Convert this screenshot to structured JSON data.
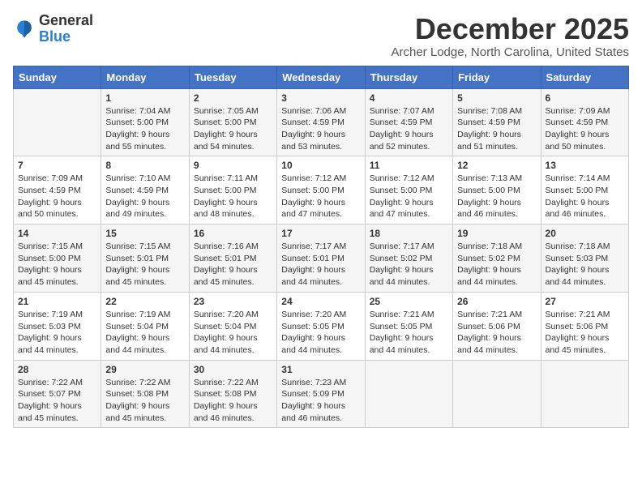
{
  "header": {
    "logo_general": "General",
    "logo_blue": "Blue",
    "month_title": "December 2025",
    "subtitle": "Archer Lodge, North Carolina, United States"
  },
  "days_of_week": [
    "Sunday",
    "Monday",
    "Tuesday",
    "Wednesday",
    "Thursday",
    "Friday",
    "Saturday"
  ],
  "weeks": [
    [
      {
        "day": "",
        "info": ""
      },
      {
        "day": "1",
        "info": "Sunrise: 7:04 AM\nSunset: 5:00 PM\nDaylight: 9 hours\nand 55 minutes."
      },
      {
        "day": "2",
        "info": "Sunrise: 7:05 AM\nSunset: 5:00 PM\nDaylight: 9 hours\nand 54 minutes."
      },
      {
        "day": "3",
        "info": "Sunrise: 7:06 AM\nSunset: 4:59 PM\nDaylight: 9 hours\nand 53 minutes."
      },
      {
        "day": "4",
        "info": "Sunrise: 7:07 AM\nSunset: 4:59 PM\nDaylight: 9 hours\nand 52 minutes."
      },
      {
        "day": "5",
        "info": "Sunrise: 7:08 AM\nSunset: 4:59 PM\nDaylight: 9 hours\nand 51 minutes."
      },
      {
        "day": "6",
        "info": "Sunrise: 7:09 AM\nSunset: 4:59 PM\nDaylight: 9 hours\nand 50 minutes."
      }
    ],
    [
      {
        "day": "7",
        "info": "Sunrise: 7:09 AM\nSunset: 4:59 PM\nDaylight: 9 hours\nand 50 minutes."
      },
      {
        "day": "8",
        "info": "Sunrise: 7:10 AM\nSunset: 4:59 PM\nDaylight: 9 hours\nand 49 minutes."
      },
      {
        "day": "9",
        "info": "Sunrise: 7:11 AM\nSunset: 5:00 PM\nDaylight: 9 hours\nand 48 minutes."
      },
      {
        "day": "10",
        "info": "Sunrise: 7:12 AM\nSunset: 5:00 PM\nDaylight: 9 hours\nand 47 minutes."
      },
      {
        "day": "11",
        "info": "Sunrise: 7:12 AM\nSunset: 5:00 PM\nDaylight: 9 hours\nand 47 minutes."
      },
      {
        "day": "12",
        "info": "Sunrise: 7:13 AM\nSunset: 5:00 PM\nDaylight: 9 hours\nand 46 minutes."
      },
      {
        "day": "13",
        "info": "Sunrise: 7:14 AM\nSunset: 5:00 PM\nDaylight: 9 hours\nand 46 minutes."
      }
    ],
    [
      {
        "day": "14",
        "info": "Sunrise: 7:15 AM\nSunset: 5:00 PM\nDaylight: 9 hours\nand 45 minutes."
      },
      {
        "day": "15",
        "info": "Sunrise: 7:15 AM\nSunset: 5:01 PM\nDaylight: 9 hours\nand 45 minutes."
      },
      {
        "day": "16",
        "info": "Sunrise: 7:16 AM\nSunset: 5:01 PM\nDaylight: 9 hours\nand 45 minutes."
      },
      {
        "day": "17",
        "info": "Sunrise: 7:17 AM\nSunset: 5:01 PM\nDaylight: 9 hours\nand 44 minutes."
      },
      {
        "day": "18",
        "info": "Sunrise: 7:17 AM\nSunset: 5:02 PM\nDaylight: 9 hours\nand 44 minutes."
      },
      {
        "day": "19",
        "info": "Sunrise: 7:18 AM\nSunset: 5:02 PM\nDaylight: 9 hours\nand 44 minutes."
      },
      {
        "day": "20",
        "info": "Sunrise: 7:18 AM\nSunset: 5:03 PM\nDaylight: 9 hours\nand 44 minutes."
      }
    ],
    [
      {
        "day": "21",
        "info": "Sunrise: 7:19 AM\nSunset: 5:03 PM\nDaylight: 9 hours\nand 44 minutes."
      },
      {
        "day": "22",
        "info": "Sunrise: 7:19 AM\nSunset: 5:04 PM\nDaylight: 9 hours\nand 44 minutes."
      },
      {
        "day": "23",
        "info": "Sunrise: 7:20 AM\nSunset: 5:04 PM\nDaylight: 9 hours\nand 44 minutes."
      },
      {
        "day": "24",
        "info": "Sunrise: 7:20 AM\nSunset: 5:05 PM\nDaylight: 9 hours\nand 44 minutes."
      },
      {
        "day": "25",
        "info": "Sunrise: 7:21 AM\nSunset: 5:05 PM\nDaylight: 9 hours\nand 44 minutes."
      },
      {
        "day": "26",
        "info": "Sunrise: 7:21 AM\nSunset: 5:06 PM\nDaylight: 9 hours\nand 44 minutes."
      },
      {
        "day": "27",
        "info": "Sunrise: 7:21 AM\nSunset: 5:06 PM\nDaylight: 9 hours\nand 45 minutes."
      }
    ],
    [
      {
        "day": "28",
        "info": "Sunrise: 7:22 AM\nSunset: 5:07 PM\nDaylight: 9 hours\nand 45 minutes."
      },
      {
        "day": "29",
        "info": "Sunrise: 7:22 AM\nSunset: 5:08 PM\nDaylight: 9 hours\nand 45 minutes."
      },
      {
        "day": "30",
        "info": "Sunrise: 7:22 AM\nSunset: 5:08 PM\nDaylight: 9 hours\nand 46 minutes."
      },
      {
        "day": "31",
        "info": "Sunrise: 7:23 AM\nSunset: 5:09 PM\nDaylight: 9 hours\nand 46 minutes."
      },
      {
        "day": "",
        "info": ""
      },
      {
        "day": "",
        "info": ""
      },
      {
        "day": "",
        "info": ""
      }
    ]
  ]
}
